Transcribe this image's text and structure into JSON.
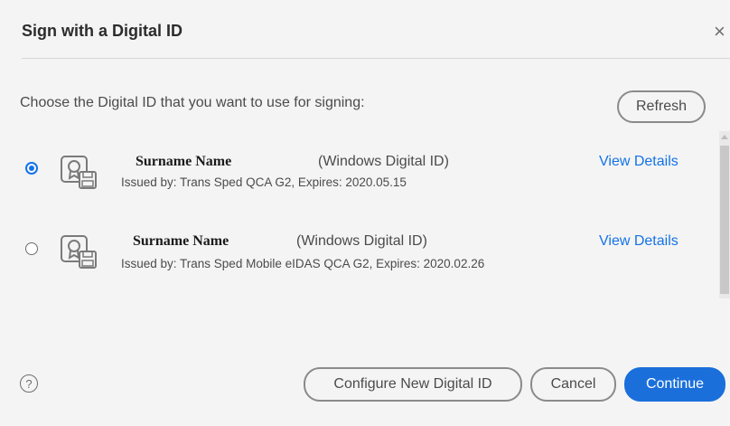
{
  "dialog": {
    "title": "Sign with a Digital ID",
    "close_glyph": "×",
    "prompt": "Choose the Digital ID that you want to use for signing:",
    "refresh_label": "Refresh"
  },
  "ids": [
    {
      "selected": true,
      "name": "Surname Name",
      "type": "(Windows Digital ID)",
      "issued": "Issued by: Trans Sped QCA G2, Expires: 2020.05.15",
      "details_label": "View Details"
    },
    {
      "selected": false,
      "name": "Surname Name",
      "type": "(Windows Digital ID)",
      "issued": "Issued by: Trans Sped Mobile eIDAS QCA G2, Expires: 2020.02.26",
      "details_label": "View Details"
    }
  ],
  "footer": {
    "help_glyph": "?",
    "configure_label": "Configure New Digital ID",
    "cancel_label": "Cancel",
    "continue_label": "Continue"
  },
  "colors": {
    "accent": "#1473e6",
    "primary_button": "#1a6fdb",
    "background": "#f4f4f4"
  },
  "icons": {
    "id": "digital-id-certificate-icon",
    "help": "help-circle-icon",
    "close": "close-icon"
  }
}
